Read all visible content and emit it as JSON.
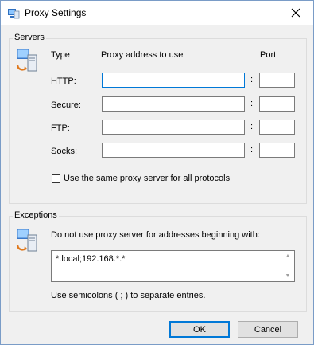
{
  "window": {
    "title": "Proxy Settings"
  },
  "servers": {
    "group_label": "Servers",
    "headers": {
      "type": "Type",
      "address": "Proxy address to use",
      "port": "Port"
    },
    "rows": [
      {
        "label": "HTTP:",
        "address": "",
        "port": ""
      },
      {
        "label": "Secure:",
        "address": "",
        "port": ""
      },
      {
        "label": "FTP:",
        "address": "",
        "port": ""
      },
      {
        "label": "Socks:",
        "address": "",
        "port": ""
      }
    ],
    "colon": ":",
    "same_proxy_label": "Use the same proxy server for all protocols"
  },
  "exceptions": {
    "group_label": "Exceptions",
    "description": "Do not use proxy server for addresses beginning with:",
    "value": "*.local;192.168.*.*",
    "hint": "Use semicolons ( ; ) to separate entries."
  },
  "buttons": {
    "ok": "OK",
    "cancel": "Cancel"
  }
}
